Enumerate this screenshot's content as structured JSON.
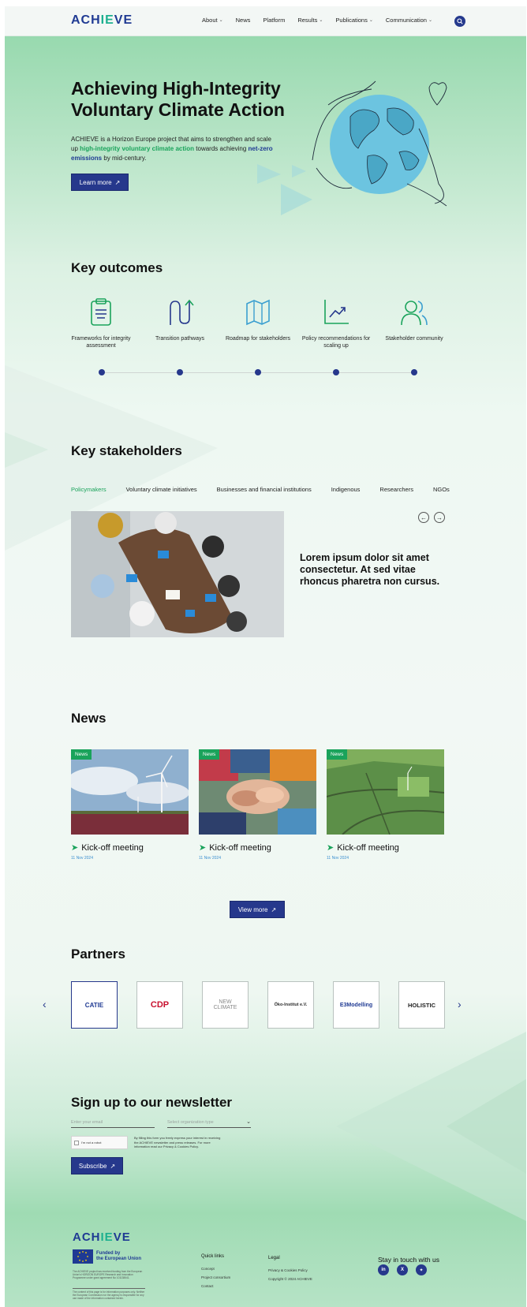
{
  "header": {
    "logo": {
      "part1": "ACH",
      "part2": "IE",
      "part3": "VE"
    },
    "nav": [
      {
        "label": "About",
        "dropdown": true
      },
      {
        "label": "News",
        "dropdown": false
      },
      {
        "label": "Platform",
        "dropdown": false
      },
      {
        "label": "Results",
        "dropdown": true
      },
      {
        "label": "Publications",
        "dropdown": true
      },
      {
        "label": "Communication",
        "dropdown": true
      }
    ],
    "search_icon": "search-icon"
  },
  "hero": {
    "title_line1": "Achieving High-Integrity",
    "title_line2": "Voluntary Climate Action",
    "text_a": "ACHIEVE is a Horizon Europe project that aims to strengthen and scale up ",
    "text_b": "high-integrity voluntary climate action",
    "text_c": " towards achieving ",
    "text_d": "net-zero emissions",
    "text_e": " by mid-century.",
    "button": "Learn more",
    "button_icon": "↗"
  },
  "outcomes": {
    "title": "Key outcomes",
    "items": [
      {
        "label": "Frameworks for integrity assessment",
        "icon": "clipboard-icon"
      },
      {
        "label": "Transition pathways",
        "icon": "transition-arrows-icon"
      },
      {
        "label": "Roadmap for stakeholders",
        "icon": "map-icon"
      },
      {
        "label": "Policy recommendations for scaling up",
        "icon": "chart-growth-icon"
      },
      {
        "label": "Stakeholder community",
        "icon": "people-icon"
      }
    ]
  },
  "stakeholders": {
    "title": "Key stakeholders",
    "tabs": [
      "Policymakers",
      "Voluntary climate initiatives",
      "Businesses and financial institutions",
      "Indigenous",
      "Researchers",
      "NGOs"
    ],
    "active_tab": 0,
    "text": "Lorem ipsum dolor sit amet consectetur. At sed vitae rhoncus pharetra non cursus.",
    "prev": "←",
    "next": "→"
  },
  "news": {
    "title": "News",
    "items": [
      {
        "badge": "News",
        "title": "Kick-off meeting",
        "date": "11 Nov 2024"
      },
      {
        "badge": "News",
        "title": "Kick-off meeting",
        "date": "11 Nov 2024"
      },
      {
        "badge": "News",
        "title": "Kick-off meeting",
        "date": "11 Nov 2024"
      }
    ],
    "view_more": "View more",
    "view_more_icon": "↗"
  },
  "partners": {
    "title": "Partners",
    "items": [
      {
        "name": "CATIE",
        "color": "#1f3a93"
      },
      {
        "name": "CDP",
        "color": "#c8102e"
      },
      {
        "name": "NEW CLIMATE",
        "color": "#888888"
      },
      {
        "name": "Öko-Institut e.V.",
        "color": "#2a2a2a"
      },
      {
        "name": "E3Modelling",
        "color": "#1f3a93"
      },
      {
        "name": "HOLISTIC",
        "color": "#222222"
      }
    ],
    "prev": "‹",
    "next": "›"
  },
  "newsletter": {
    "title": "Sign up to our newsletter",
    "email_placeholder": "Enter your email",
    "type_placeholder": "Select organization type",
    "captcha_label": "I'm not a robot",
    "consent": "By filling this form you freely express your interest in receiving the ACHIEVE newsletter and press releases. For more information read our Privacy & Cookies Policy.",
    "button": "Subscribe",
    "button_icon": "↗"
  },
  "footer": {
    "eu_line1": "Funded by",
    "eu_line2": "the European Union",
    "small1": "The ACHIEVE project has received funding from the European Union's HORIZON EUROPE Research and Innovation Programme under grant agreement No 101138641.",
    "small2": "The content of this page is for information purposes only. Neither the European Commission nor the agency is responsible for any use made of the information contained herein.",
    "quick_title": "Quick links",
    "quick_links": [
      "Concept",
      "Project consortium",
      "Contact"
    ],
    "legal_title": "Legal",
    "legal_links": [
      "Privacy & Cookies Policy",
      "Copyright © 2024 ACHIEVE"
    ],
    "social_title": "Stay in touch with us",
    "social": [
      {
        "label": "in",
        "icon": "linkedin-icon"
      },
      {
        "label": "X",
        "icon": "x-icon"
      },
      {
        "label": "✦",
        "icon": "bluesky-icon"
      }
    ]
  },
  "colors": {
    "brand_blue": "#26388c",
    "brand_green": "#1aa35b",
    "accent_teal": "#1cb08f"
  }
}
